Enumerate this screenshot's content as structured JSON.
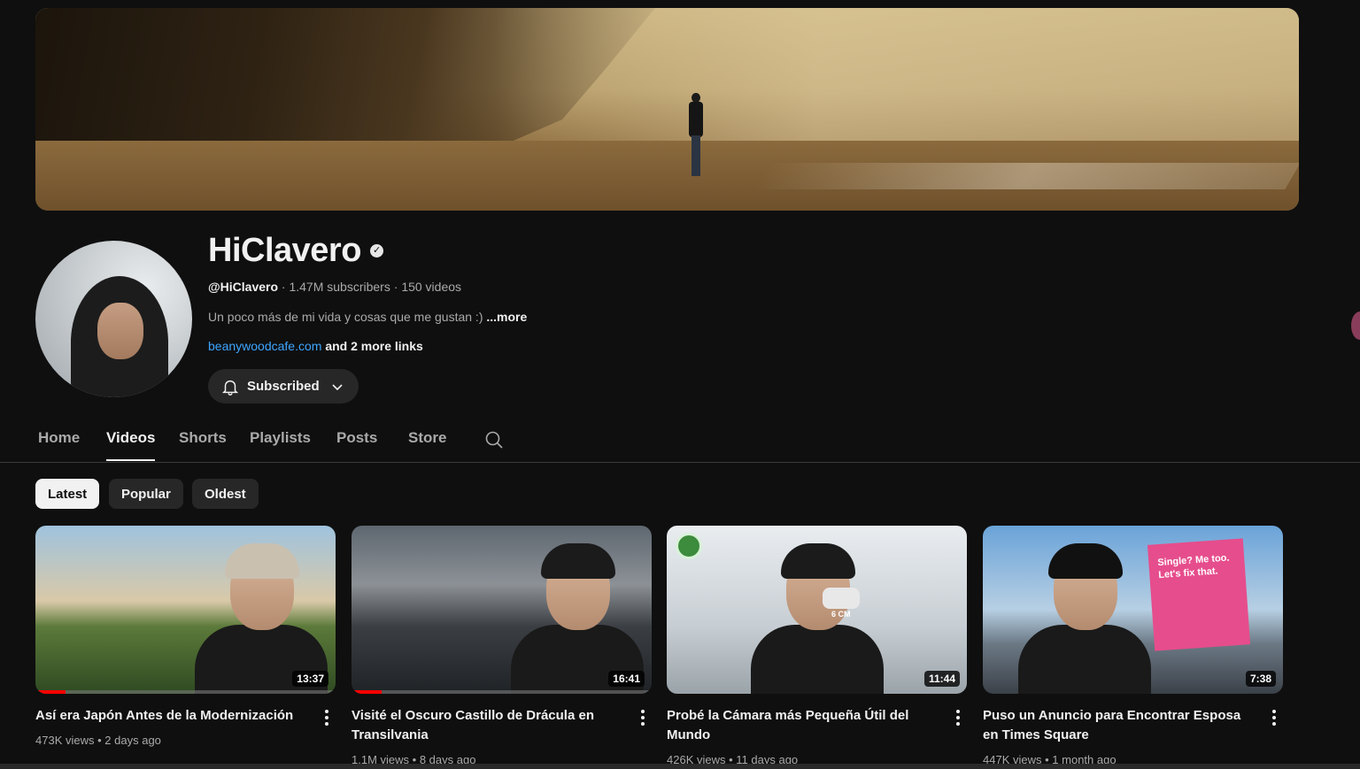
{
  "channel": {
    "name": "HiClavero",
    "handle": "@HiClavero",
    "subscribers": "1.47M subscribers",
    "videos_count": "150 videos",
    "separator": "·",
    "description": "Un poco más de mi vida y cosas que me gustan :)",
    "description_more": "...more",
    "link": "beanywoodcafe.com",
    "more_links": "and 2 more links",
    "subscribe_label": "Subscribed",
    "verified_glyph": "✓"
  },
  "tabs": [
    {
      "label": "Home"
    },
    {
      "label": "Videos",
      "active": true
    },
    {
      "label": "Shorts"
    },
    {
      "label": "Playlists"
    },
    {
      "label": "Posts"
    },
    {
      "label": "Store"
    }
  ],
  "filters": [
    {
      "label": "Latest",
      "active": true
    },
    {
      "label": "Popular"
    },
    {
      "label": "Oldest"
    }
  ],
  "videos": [
    {
      "title": "Así era Japón Antes de la Modernización",
      "views": "473K views",
      "age": "2 days ago",
      "duration": "13:37",
      "watched_fraction": 0.1
    },
    {
      "title": "Visité el Oscuro Castillo de Drácula en Transilvania",
      "views": "1.1M views",
      "age": "8 days ago",
      "duration": "16:41",
      "watched_fraction": 0.1
    },
    {
      "title": "Probé la Cámara más Pequeña Útil del Mundo",
      "views": "426K views",
      "age": "11 days ago",
      "duration": "11:44",
      "thumb_label": "6 CM"
    },
    {
      "title": "Puso un Anuncio para Encontrar Esposa en Times Square",
      "views": "447K views",
      "age": "1 month ago",
      "duration": "7:38",
      "billboard_text": "Single? Me too. Let's fix that."
    }
  ],
  "stats_separator": "•",
  "colors": {
    "background": "#0f0f0f",
    "link": "#3ea6ff",
    "progress": "#ff0000",
    "chip_active": "#f1f1f1"
  }
}
